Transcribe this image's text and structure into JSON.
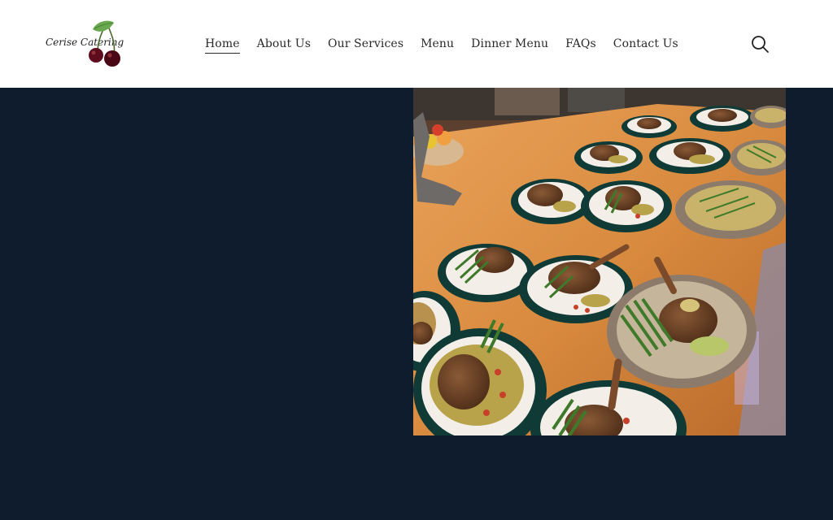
{
  "brand": {
    "logo_text": "Cerise Catering",
    "logo_icon": "cherries-icon",
    "colors": {
      "header_bg": "#ffffff",
      "hero_bg": "#0e1c2d",
      "cherry": "#5e0d1e",
      "leaf": "#6aa84f"
    }
  },
  "nav": {
    "items": [
      {
        "label": "Home",
        "active": true
      },
      {
        "label": "About Us"
      },
      {
        "label": "Our Services"
      },
      {
        "label": "Menu"
      },
      {
        "label": "Dinner Menu"
      },
      {
        "label": "FAQs"
      },
      {
        "label": "Contact Us"
      }
    ],
    "search_icon": "search-icon"
  },
  "hero": {
    "image_subject": "plated lamb shank dinners with couscous and green beans on a wooden counter"
  }
}
